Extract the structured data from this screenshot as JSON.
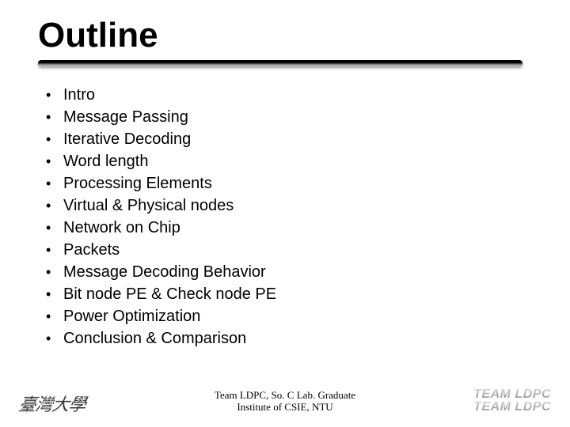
{
  "title": "Outline",
  "bullets": [
    "Intro",
    "Message Passing",
    "Iterative Decoding",
    "Word length",
    "Processing Elements",
    "Virtual & Physical nodes",
    "Network on Chip",
    "Packets",
    "Message Decoding Behavior",
    "Bit node PE & Check node PE",
    "Power Optimization",
    "Conclusion & Comparison"
  ],
  "footer": {
    "center_line1": "Team LDPC, So. C Lab. Graduate",
    "center_line2": "Institute of CSIE, NTU",
    "left_logo": "臺灣大學",
    "right_logo": "TEAM LDPC"
  }
}
